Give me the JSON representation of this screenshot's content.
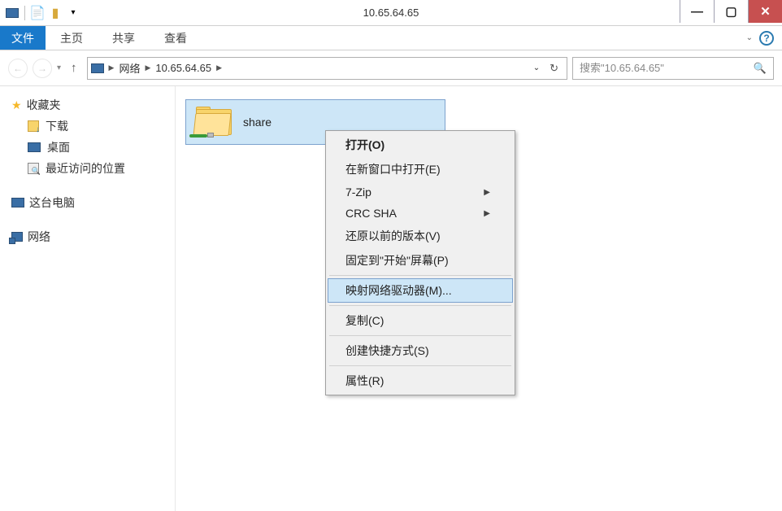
{
  "window": {
    "title": "10.65.64.65"
  },
  "ribbon": {
    "file": "文件",
    "tabs": [
      "主页",
      "共享",
      "查看"
    ]
  },
  "addressbar": {
    "parts": [
      "网络",
      "10.65.64.65"
    ]
  },
  "search": {
    "placeholder": "搜索\"10.65.64.65\""
  },
  "sidebar": {
    "favorites": {
      "label": "收藏夹",
      "items": [
        "下载",
        "桌面",
        "最近访问的位置"
      ]
    },
    "this_pc": {
      "label": "这台电脑"
    },
    "network": {
      "label": "网络"
    }
  },
  "main": {
    "items": [
      {
        "name": "share"
      }
    ]
  },
  "context_menu": {
    "items": [
      {
        "label": "打开(O)"
      },
      {
        "label": "在新窗口中打开(E)"
      },
      {
        "label": "7-Zip",
        "submenu": true
      },
      {
        "label": "CRC SHA",
        "submenu": true
      },
      {
        "label": "还原以前的版本(V)"
      },
      {
        "label": "固定到\"开始\"屏幕(P)"
      },
      {
        "sep": true
      },
      {
        "label": "映射网络驱动器(M)...",
        "highlighted": true
      },
      {
        "sep": true
      },
      {
        "label": "复制(C)"
      },
      {
        "sep": true
      },
      {
        "label": "创建快捷方式(S)"
      },
      {
        "sep": true
      },
      {
        "label": "属性(R)"
      }
    ]
  }
}
